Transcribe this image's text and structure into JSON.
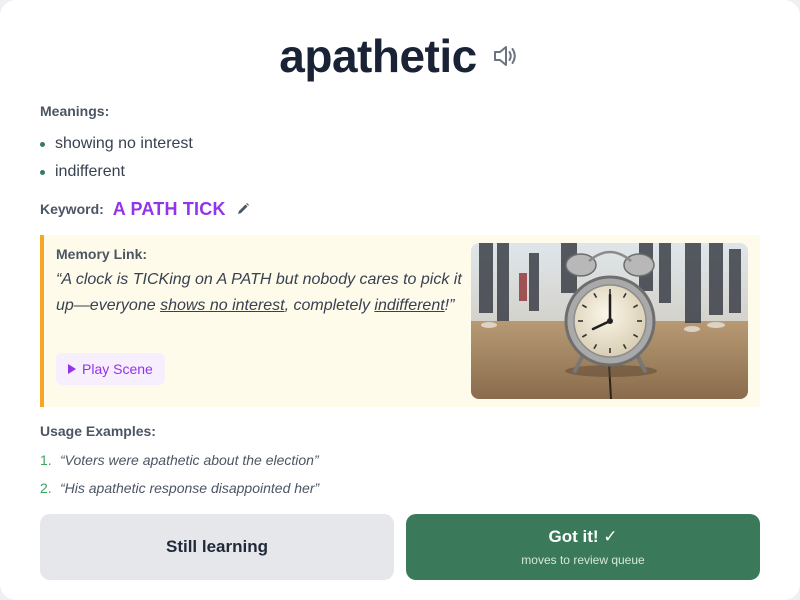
{
  "word": "apathetic",
  "meanings": {
    "label": "Meanings:",
    "items": [
      "showing no interest",
      "indifferent"
    ]
  },
  "keyword": {
    "label": "Keyword:",
    "value": "A PATH TICK"
  },
  "memory": {
    "label": "Memory Link:",
    "story_part1": "“A clock is TICKing on A PATH but nobody cares to pick it up—everyone ",
    "story_u1": "shows no interest",
    "story_part2": ", completely ",
    "story_u2": "indifferent",
    "story_part3": "!”",
    "play_label": "Play Scene"
  },
  "usage": {
    "label": "Usage Examples:",
    "items": [
      {
        "num": "1.",
        "text": "“Voters were apathetic about the election”"
      },
      {
        "num": "2.",
        "text": "“His apathetic response disappointed her”"
      }
    ]
  },
  "buttons": {
    "still_learning": "Still learning",
    "got_it": "Got it! ✓",
    "got_it_sub": "moves to review queue"
  },
  "colors": {
    "keyword": "#9333ea",
    "accent_green": "#3a7a5a",
    "memory_bg": "#fffbea",
    "memory_border": "#f5a623"
  },
  "icons": [
    "speaker-icon",
    "pencil-icon",
    "play-icon",
    "clock-scene-image"
  ]
}
